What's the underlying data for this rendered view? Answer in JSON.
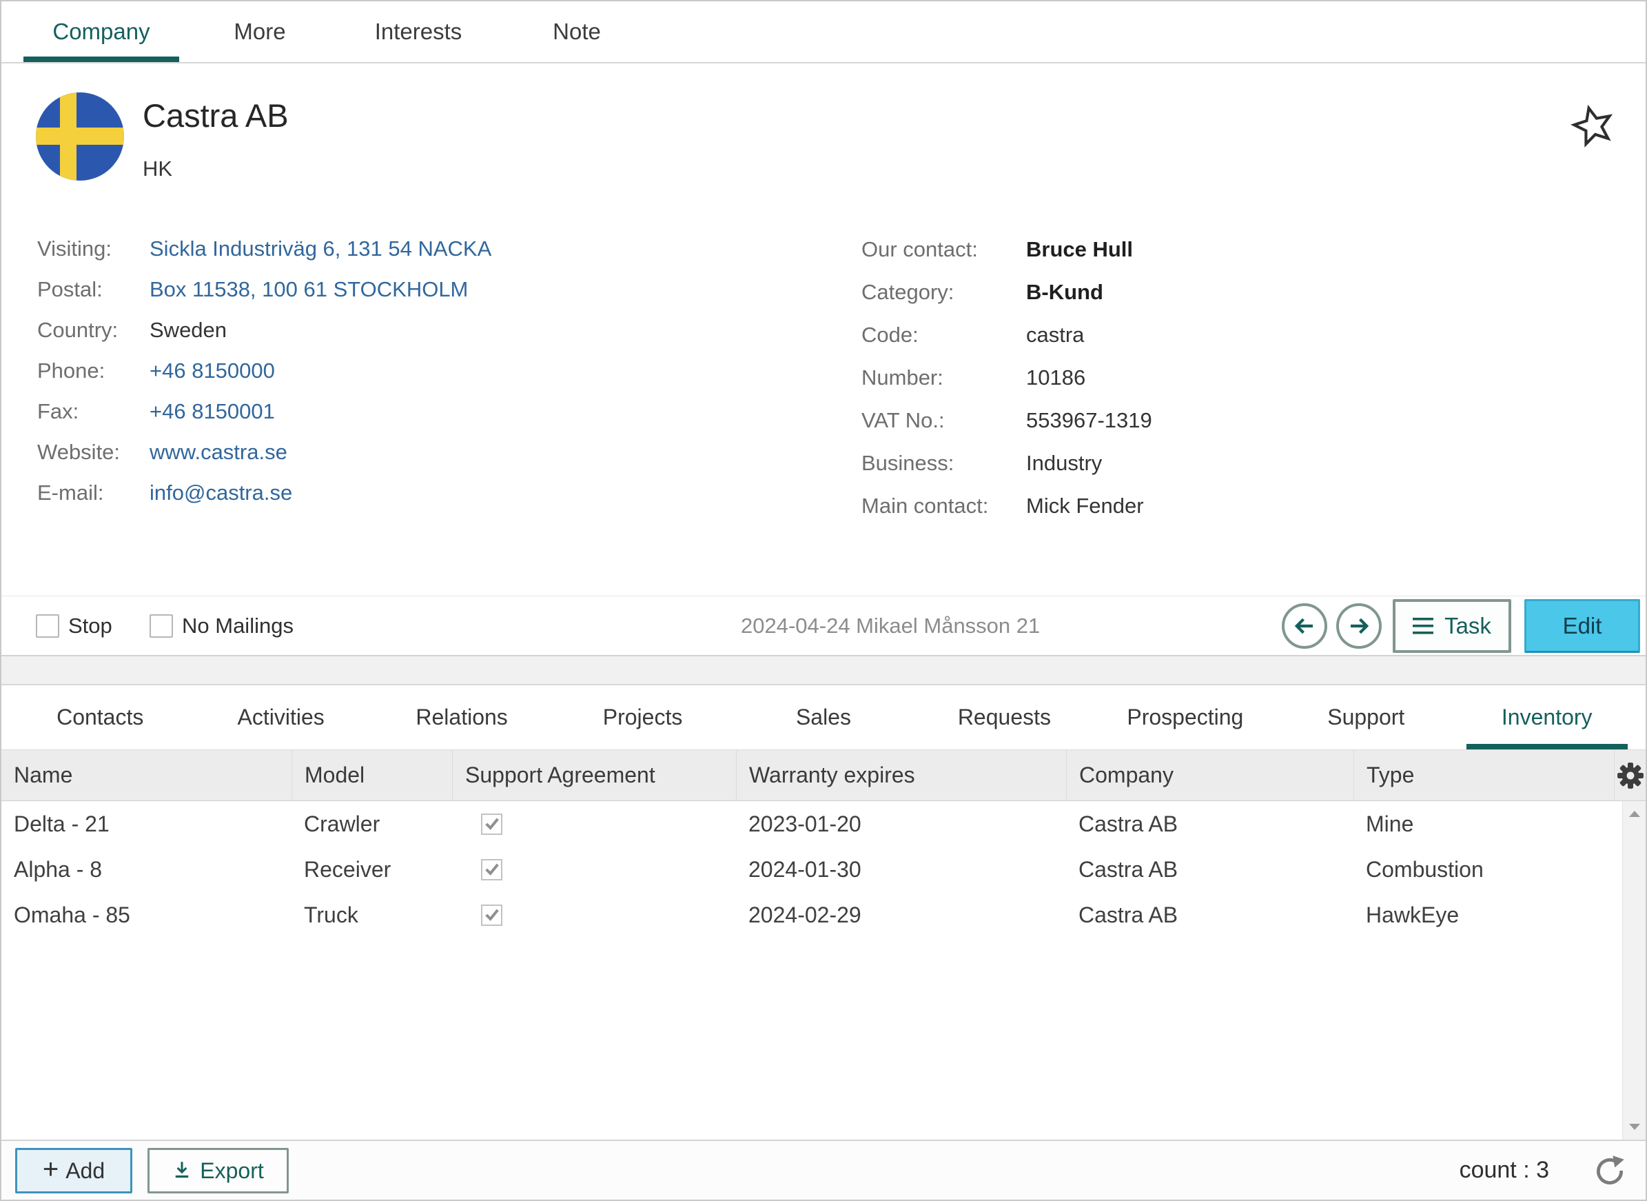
{
  "top_tabs": {
    "items": [
      {
        "label": "Company",
        "active": true
      },
      {
        "label": "More",
        "active": false
      },
      {
        "label": "Interests",
        "active": false
      },
      {
        "label": "Note",
        "active": false
      }
    ]
  },
  "company": {
    "name": "Castra AB",
    "subtitle": "HK",
    "flag": "sweden-flag-avatar",
    "left_details": [
      {
        "label": "Visiting:",
        "value": "Sickla Industriväg 6, 131 54 NACKA",
        "link": true
      },
      {
        "label": "Postal:",
        "value": "Box 11538, 100 61 STOCKHOLM",
        "link": true
      },
      {
        "label": "Country:",
        "value": "Sweden",
        "link": false
      },
      {
        "label": "Phone:",
        "value": "+46 8150000",
        "link": true
      },
      {
        "label": "Fax:",
        "value": "+46 8150001",
        "link": true
      },
      {
        "label": "Website:",
        "value": "www.castra.se",
        "link": true
      },
      {
        "label": "E-mail:",
        "value": "info@castra.se",
        "link": true
      }
    ],
    "right_details": [
      {
        "label": "Our contact:",
        "value": "Bruce Hull",
        "bold": true
      },
      {
        "label": "Category:",
        "value": "B-Kund",
        "bold": true
      },
      {
        "label": "Code:",
        "value": "castra",
        "bold": false
      },
      {
        "label": "Number:",
        "value": "10186",
        "bold": false
      },
      {
        "label": "VAT No.:",
        "value": "553967-1319",
        "bold": false
      },
      {
        "label": "Business:",
        "value": "Industry",
        "bold": false
      },
      {
        "label": "Main contact:",
        "value": "Mick Fender",
        "bold": false
      }
    ]
  },
  "card_footer": {
    "stop_label": "Stop",
    "stop_checked": false,
    "no_mailings_label": "No Mailings",
    "no_mailings_checked": false,
    "timestamp": "2024-04-24 Mikael Månsson 21",
    "task_label": "Task",
    "edit_label": "Edit"
  },
  "lower_tabs": {
    "items": [
      {
        "label": "Contacts",
        "active": false
      },
      {
        "label": "Activities",
        "active": false
      },
      {
        "label": "Relations",
        "active": false
      },
      {
        "label": "Projects",
        "active": false
      },
      {
        "label": "Sales",
        "active": false
      },
      {
        "label": "Requests",
        "active": false
      },
      {
        "label": "Prospecting",
        "active": false
      },
      {
        "label": "Support",
        "active": false
      },
      {
        "label": "Inventory",
        "active": true
      }
    ]
  },
  "inventory_table": {
    "columns": [
      "Name",
      "Model",
      "Support Agreement",
      "Warranty expires",
      "Company",
      "Type"
    ],
    "rows": [
      {
        "name": "Delta - 21",
        "model": "Crawler",
        "support_agreement": true,
        "warranty_expires": "2023-01-20",
        "company": "Castra AB",
        "type": "Mine"
      },
      {
        "name": "Alpha - 8",
        "model": "Receiver",
        "support_agreement": true,
        "warranty_expires": "2024-01-30",
        "company": "Castra AB",
        "type": "Combustion"
      },
      {
        "name": "Omaha - 85",
        "model": "Truck",
        "support_agreement": true,
        "warranty_expires": "2024-02-29",
        "company": "Castra AB",
        "type": "HawkEye"
      }
    ]
  },
  "bottom_bar": {
    "add_label": "Add",
    "export_label": "Export",
    "count_label": "count : 3"
  },
  "colors": {
    "accent_teal": "#14605c",
    "link_blue": "#31679c",
    "edit_button_bg": "#4ac7e9",
    "button_border_sage": "#81968e",
    "add_button_border": "#3e93ba",
    "table_header_bg": "#ececec",
    "flag_blue": "#2b58ae",
    "flag_yellow": "#f3d03c"
  }
}
